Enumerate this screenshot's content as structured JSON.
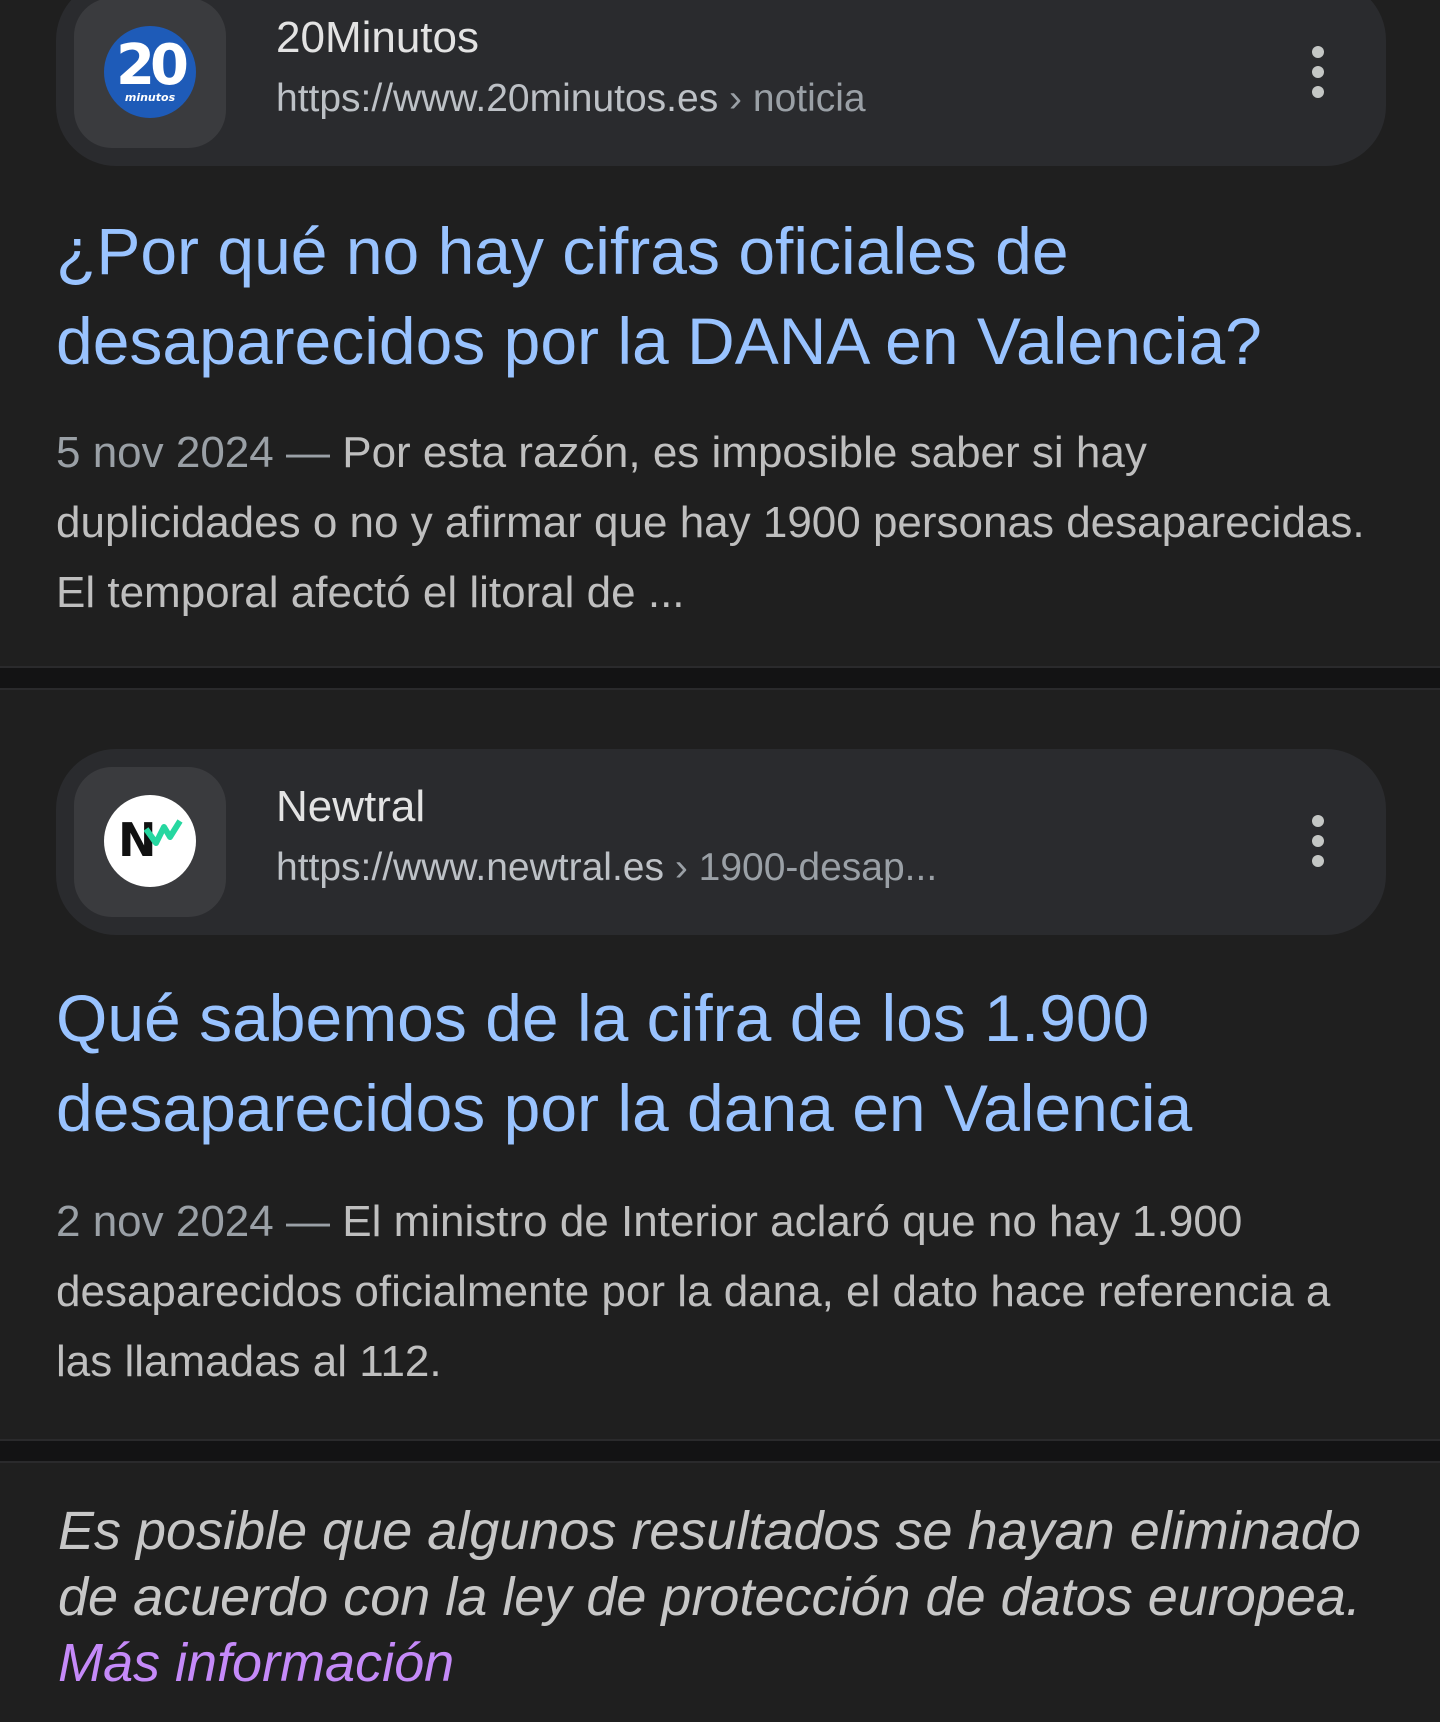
{
  "results": [
    {
      "site_name": "20Minutos",
      "favicon": {
        "text": "20",
        "subtext": "minutos",
        "color": "#1e5bb8"
      },
      "url_domain": "https://www.20minutos.es",
      "url_separator": "›",
      "url_path": "noticia",
      "title_line1": "¿Por qué no hay cifras oficiales de",
      "title_line2": "desaparecidos por la DANA en Valencia?",
      "date": "5 nov 2024",
      "dash": "—",
      "snippet": "Por esta razón, es imposible saber si hay duplicidades o no y afirmar que hay 1900 personas desaparecidas. El temporal afectó el litoral de ..."
    },
    {
      "site_name": "Newtral",
      "favicon": {
        "text": "N",
        "color": "#ffffff",
        "accent": "#26d7a0"
      },
      "url_domain": "https://www.newtral.es",
      "url_separator": "›",
      "url_path": "1900-desap...",
      "title_line1": "Qué sabemos de la cifra de los 1.900",
      "title_line2": "desaparecidos por la dana en Valencia",
      "date": "2 nov 2024",
      "dash": "—",
      "snippet": "El ministro de Interior aclaró que no hay 1.900 desaparecidos oficialmente por la dana, el dato hace referencia a las llamadas al 112."
    }
  ],
  "notice": {
    "text": "Es posible que algunos resultados se hayan eliminado de acuerdo con la ley de protección de datos europea.",
    "link_label": "Más información"
  },
  "colors": {
    "background": "#1f1f1f",
    "title_link": "#99c3ff",
    "info_link": "#c58af9"
  },
  "icons": {
    "menu": "more-vert-icon"
  }
}
